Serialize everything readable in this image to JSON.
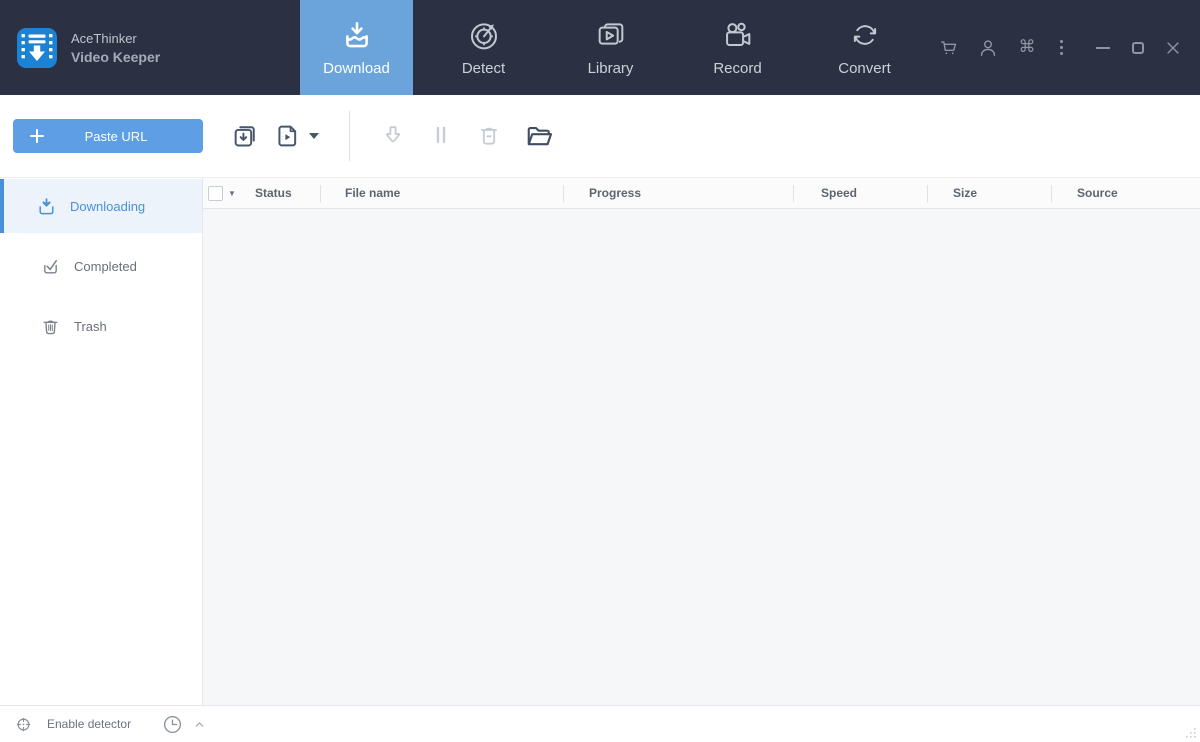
{
  "brand": {
    "line1": "AceThinker",
    "line2": "Video Keeper"
  },
  "nav": {
    "tabs": [
      {
        "label": "Download",
        "icon": "download-tray-icon",
        "active": true
      },
      {
        "label": "Detect",
        "icon": "gauge-icon",
        "active": false
      },
      {
        "label": "Library",
        "icon": "video-library-icon",
        "active": false
      },
      {
        "label": "Record",
        "icon": "movie-camera-icon",
        "active": false
      },
      {
        "label": "Convert",
        "icon": "sync-arrows-icon",
        "active": false
      }
    ]
  },
  "header_actions": {
    "icons": [
      "cart-icon",
      "account-icon",
      "command-icon",
      "more-vertical-icon"
    ],
    "window_controls": [
      "minimize",
      "maximize",
      "close"
    ]
  },
  "glyphs": {
    "command": "⌘",
    "select_caret": "▼"
  },
  "toolbar": {
    "paste_url_label": "Paste URL",
    "icons": [
      "batch-download-icon",
      "video-file-icon",
      "dropdown-caret",
      "resume-download-icon",
      "pause-icon",
      "trash-minus-icon",
      "open-folder-icon"
    ]
  },
  "sidebar": {
    "items": [
      {
        "label": "Downloading",
        "icon": "download-tray-icon",
        "active": true
      },
      {
        "label": "Completed",
        "icon": "check-tray-icon",
        "active": false
      },
      {
        "label": "Trash",
        "icon": "trash-icon",
        "active": false
      }
    ]
  },
  "table": {
    "columns": [
      "Status",
      "File name",
      "Progress",
      "Speed",
      "Size",
      "Source"
    ],
    "rows": []
  },
  "statusbar": {
    "detector_label": "Enable detector",
    "icons": [
      "detector-target-icon",
      "schedule-clock-icon",
      "chevron-up-icon"
    ]
  },
  "colors": {
    "header_bg": "#2b3143",
    "active_tab_bg": "#6aa4da",
    "paste_button_bg": "#5d9ee4",
    "accent_blue": "#4a90d9",
    "sidebar_active_bg": "#edf3fa",
    "table_body_bg": "#f6f7f8",
    "logo_blue": "#1b82d4"
  }
}
